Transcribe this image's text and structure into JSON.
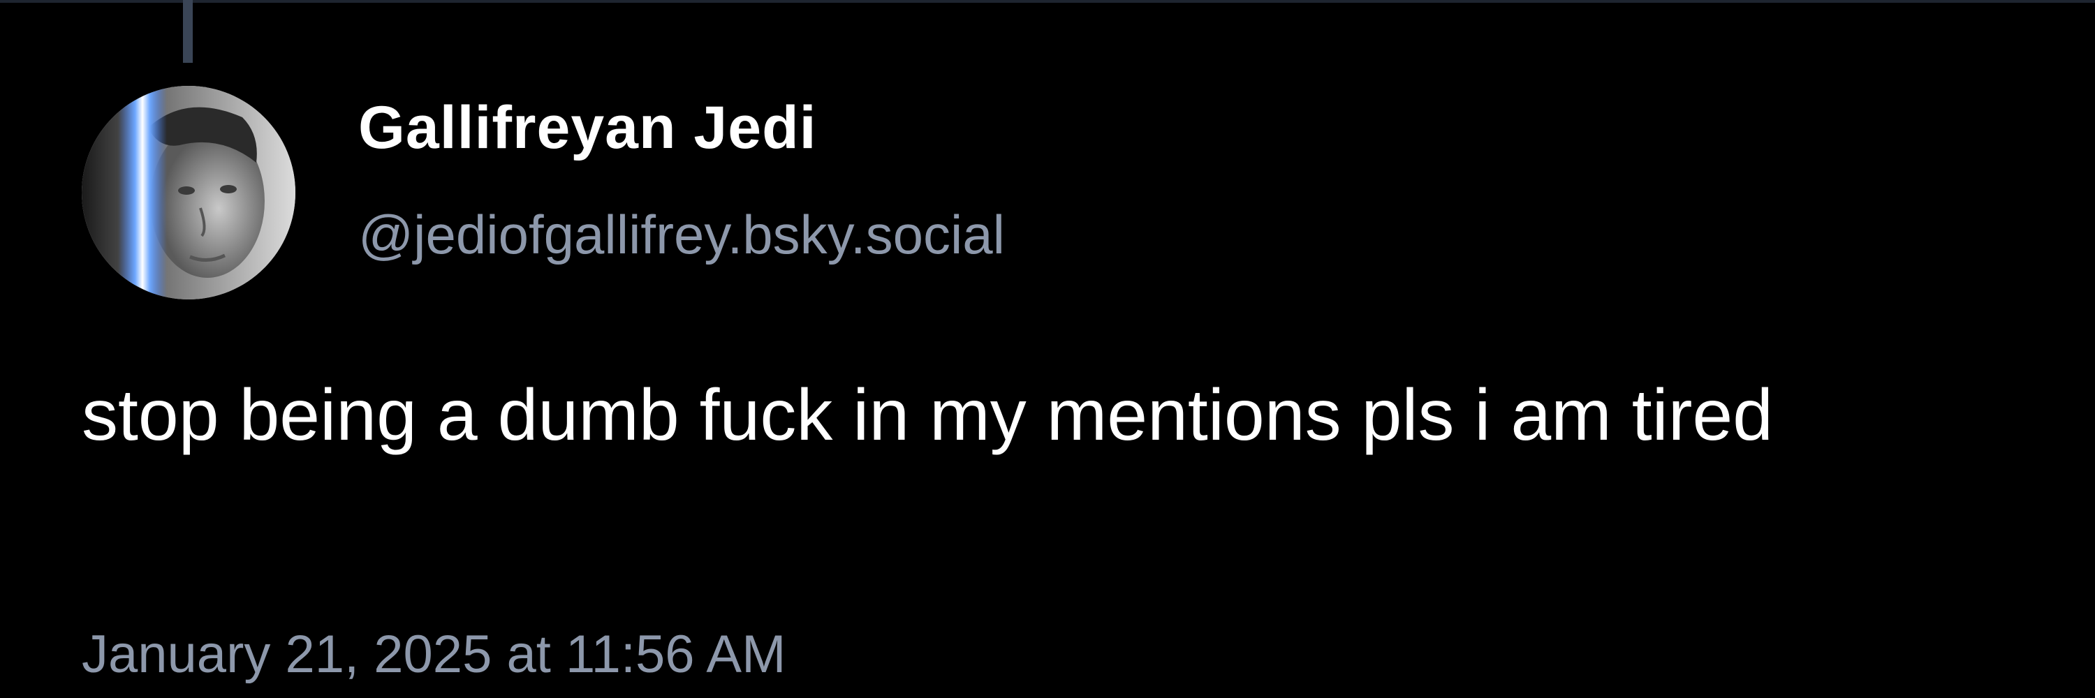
{
  "post": {
    "author": {
      "display_name": "Gallifreyan Jedi",
      "handle": "@jediofgallifrey.bsky.social",
      "avatar_icon": "profile-photo-with-blue-lightsaber"
    },
    "text": "stop being a dumb fuck in my mentions pls i am tired",
    "timestamp": "January 21, 2025 at 11:56 AM"
  },
  "colors": {
    "background": "#000000",
    "primary_text": "#ffffff",
    "secondary_text": "#8d98ab",
    "thread_line": "#3a4556"
  }
}
